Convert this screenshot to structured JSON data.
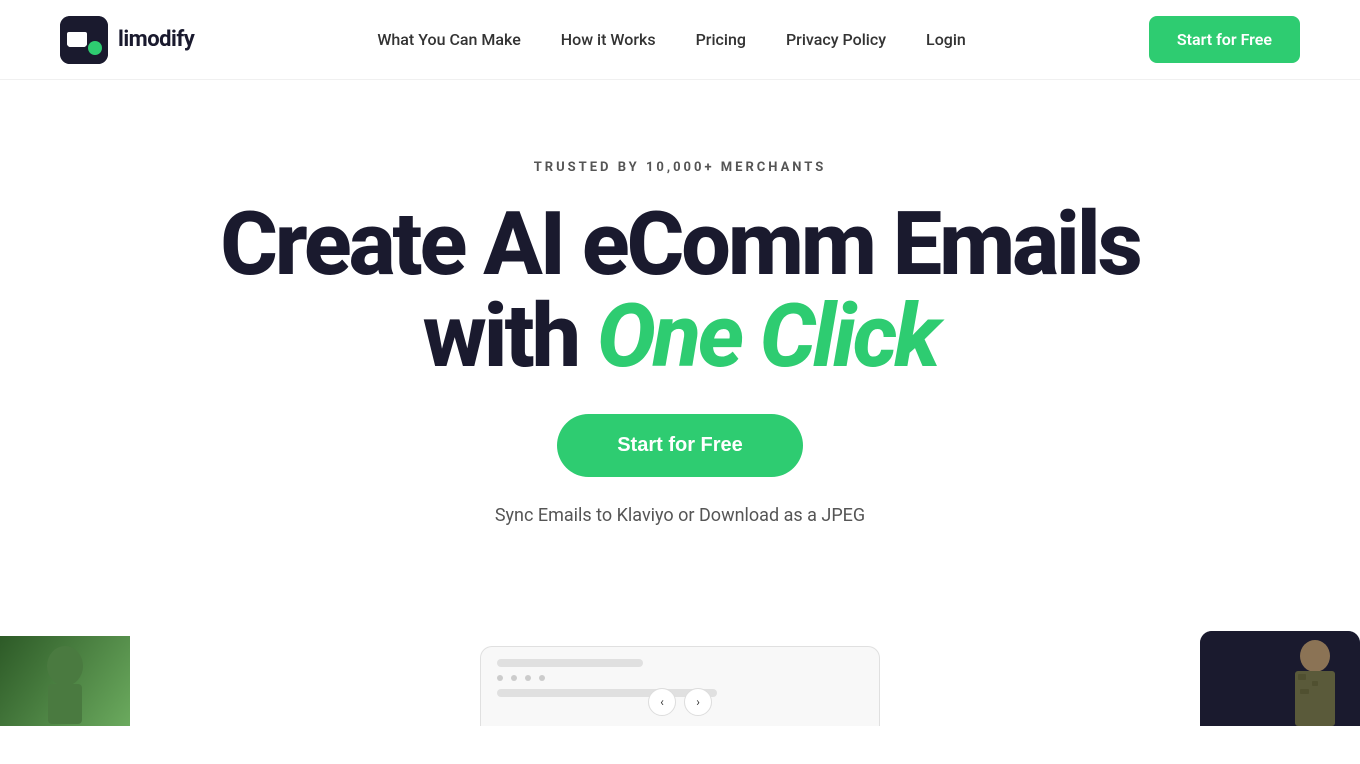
{
  "brand": {
    "name": "limodify",
    "logo_alt": "Limodify logo"
  },
  "nav": {
    "links": [
      {
        "id": "what-you-can-make",
        "label": "What You Can Make"
      },
      {
        "id": "how-it-works",
        "label": "How it Works"
      },
      {
        "id": "pricing",
        "label": "Pricing"
      },
      {
        "id": "privacy-policy",
        "label": "Privacy Policy"
      },
      {
        "id": "login",
        "label": "Login"
      }
    ],
    "cta_label": "Start for Free"
  },
  "hero": {
    "trusted_badge": "TRUSTED BY 10,000+ MERCHANTS",
    "headline_line1": "Create AI eComm Emails",
    "headline_line2_prefix": "with ",
    "headline_line2_italic": "One Click",
    "cta_label": "Start for Free",
    "subtext": "Sync Emails to Klaviyo or Download as a JPEG"
  },
  "colors": {
    "accent_green": "#2ecc71",
    "dark_navy": "#1a1a2e"
  }
}
